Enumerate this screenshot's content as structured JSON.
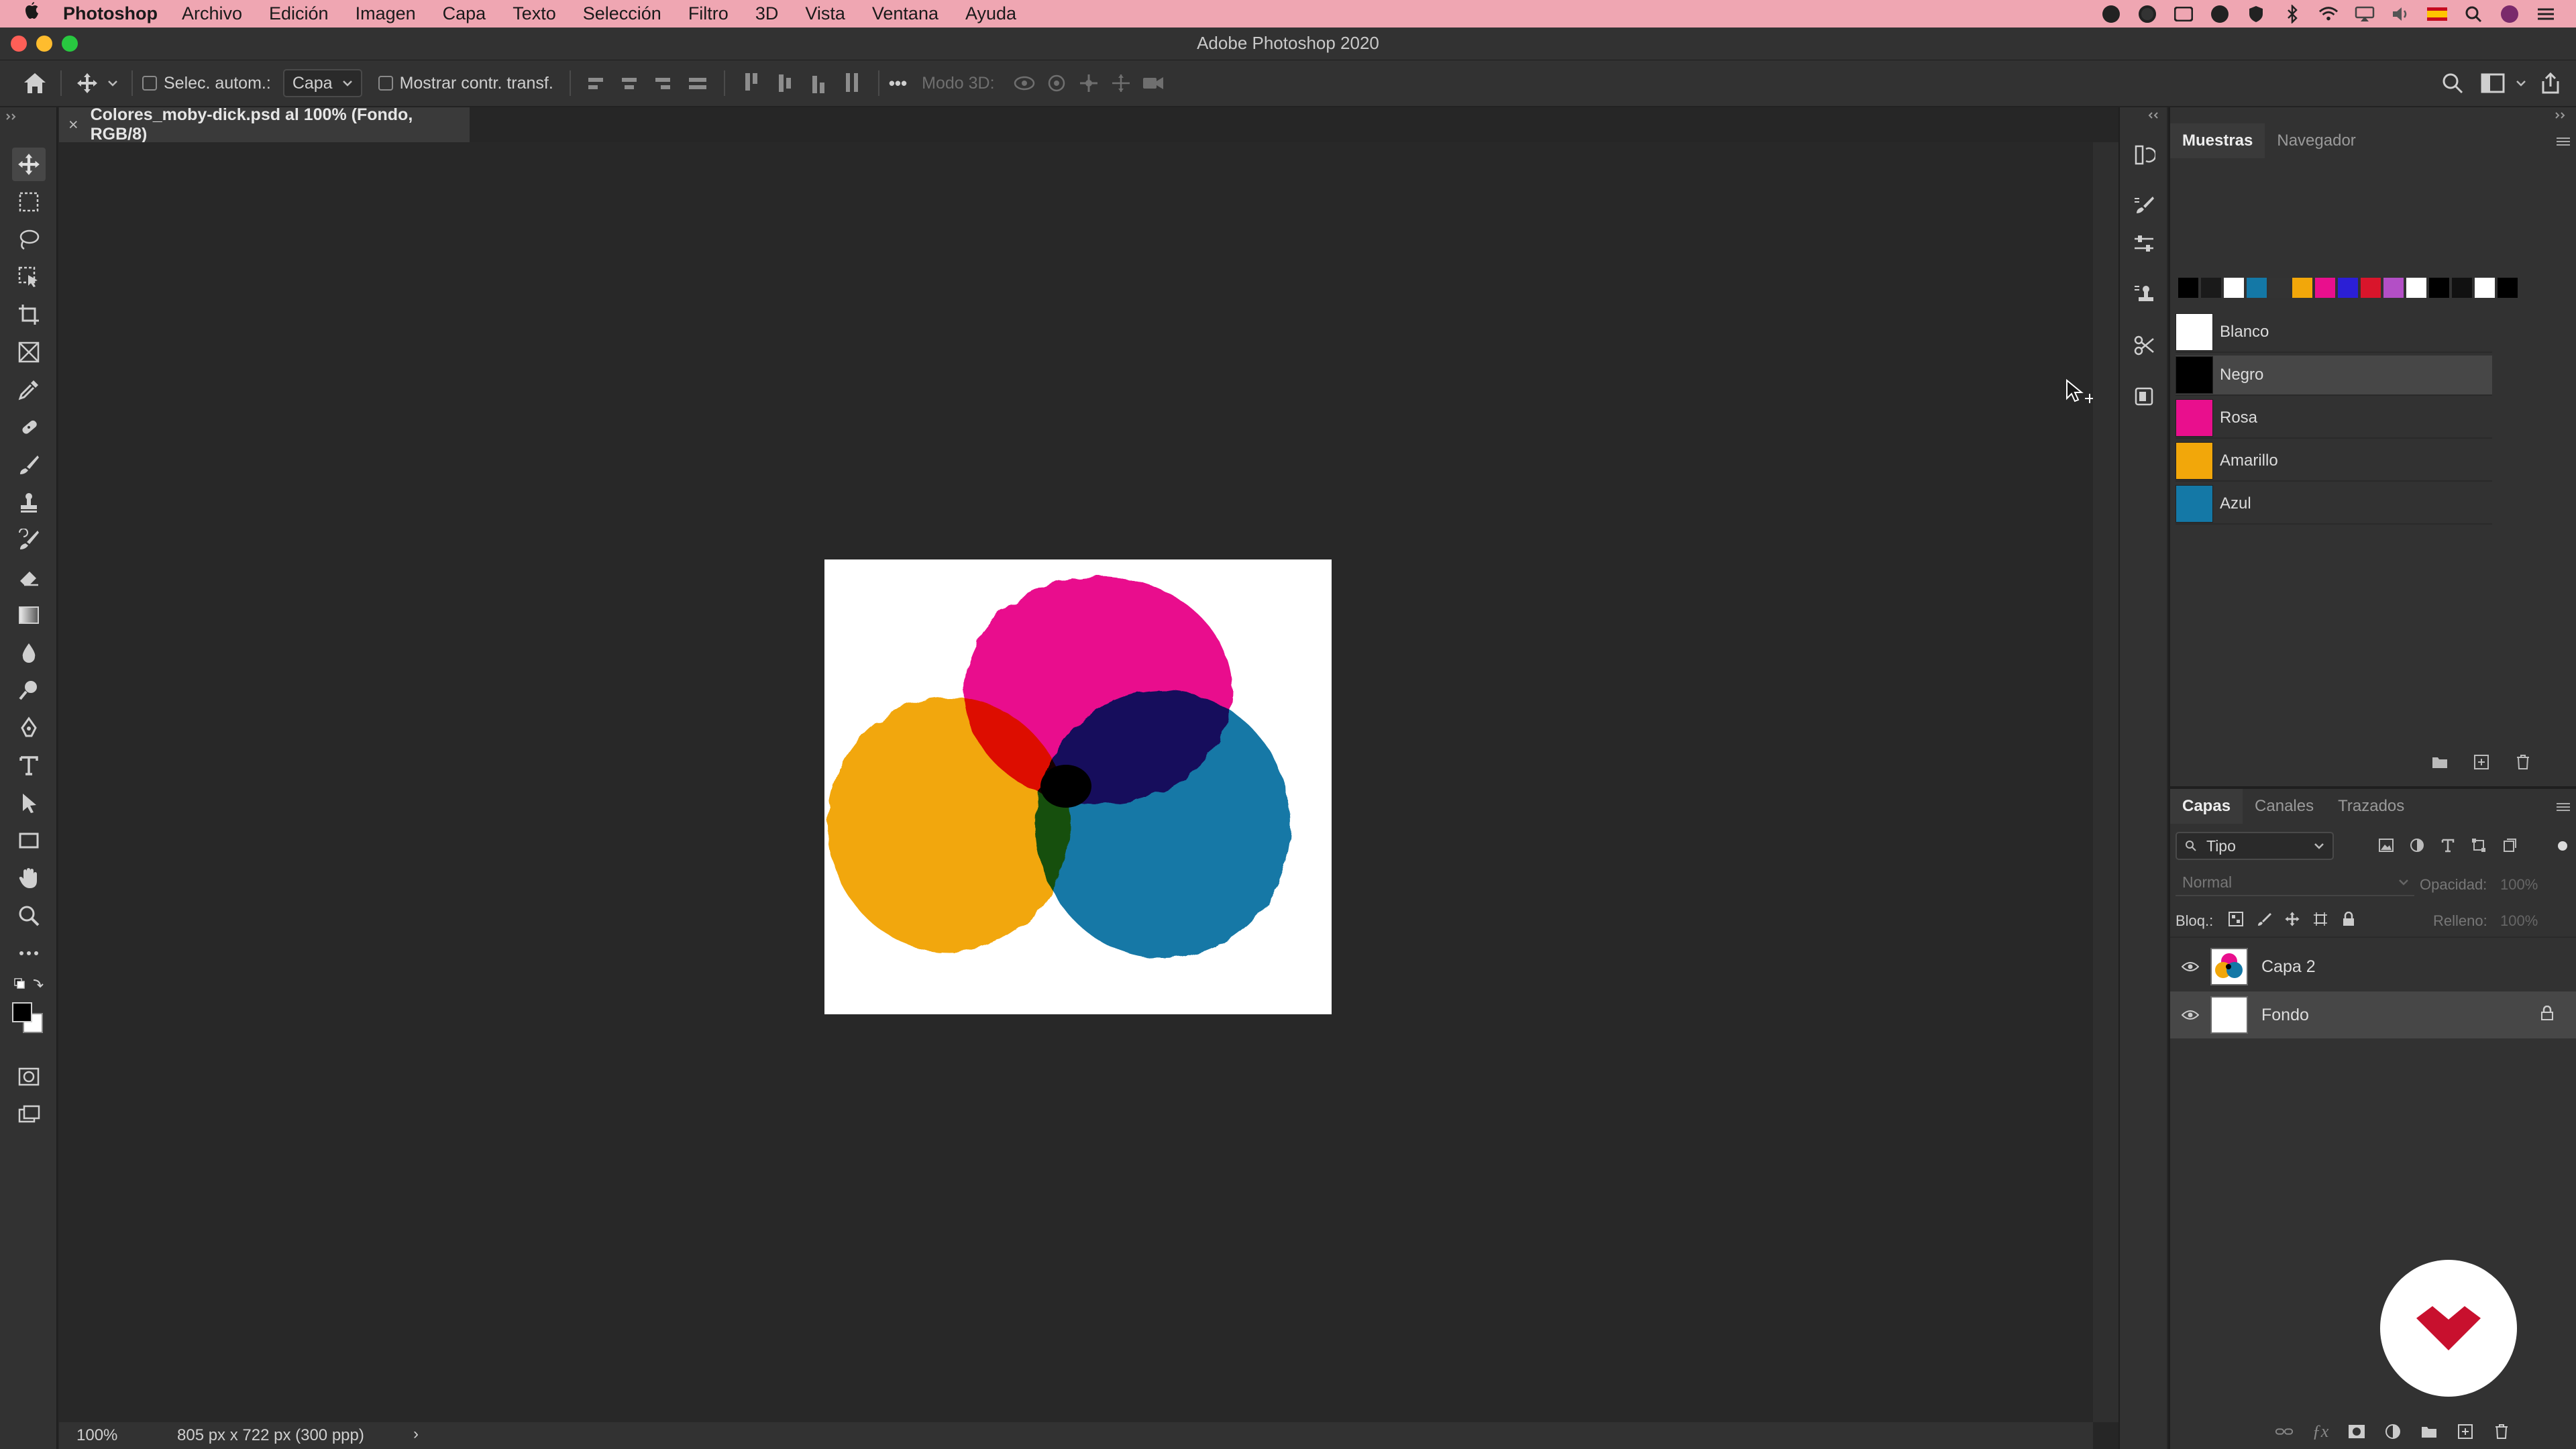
{
  "menubar": {
    "app_name": "Photoshop",
    "items": [
      "Archivo",
      "Edición",
      "Imagen",
      "Capa",
      "Texto",
      "Selección",
      "Filtro",
      "3D",
      "Vista",
      "Ventana",
      "Ayuda"
    ],
    "status_icons": [
      "app-icon",
      "app-icon",
      "app-icon",
      "app-icon",
      "app-icon",
      "bluetooth-icon",
      "wifi-icon",
      "airplay-icon",
      "volume-icon",
      "flag-es-icon",
      "search-icon",
      "avatar-icon",
      "control-center-icon"
    ]
  },
  "window": {
    "title": "Adobe Photoshop 2020"
  },
  "options": {
    "auto_select_label": "Selec. autom.:",
    "auto_select_value": "Capa",
    "show_transform_label": "Mostrar contr. transf.",
    "mode3d_label": "Modo 3D:",
    "more_label": "•••"
  },
  "document": {
    "tab_title": "Colores_moby-dick.psd al 100% (Fondo, RGB/8)",
    "close_glyph": "×",
    "zoom": "100%",
    "info": "805 px x 722 px (300 ppp)",
    "info_arrow": "›"
  },
  "swatches_panel": {
    "tabs": [
      "Muestras",
      "Navegador"
    ],
    "palette": [
      "#000000",
      "#1a1a1a",
      "#ffffff",
      "#1478a6",
      "#333333",
      "#f2a70a",
      "#e90f8d",
      "#2b1fd6",
      "#d9152b",
      "#b34fc6",
      "#ffffff",
      "#000000",
      "#111111",
      "#ffffff",
      "#000000"
    ],
    "items": [
      {
        "name": "Blanco",
        "color": "#ffffff"
      },
      {
        "name": "Negro",
        "color": "#000000"
      },
      {
        "name": "Rosa",
        "color": "#e90f8d"
      },
      {
        "name": "Amarillo",
        "color": "#f2a70a"
      },
      {
        "name": "Azul",
        "color": "#1478a6"
      }
    ]
  },
  "layers_panel": {
    "tabs": [
      "Capas",
      "Canales",
      "Trazados"
    ],
    "filter_value": "Tipo",
    "blend_mode": "Normal",
    "opacity_label": "Opacidad:",
    "opacity_value": "100%",
    "lock_label": "Bloq.:",
    "fill_label": "Relleno:",
    "fill_value": "100%",
    "layers": [
      {
        "name": "Capa 2"
      },
      {
        "name": "Fondo"
      }
    ]
  },
  "colors": {
    "magenta": "#e90f8d",
    "yellow": "#f2a70a",
    "cyan": "#1478a6",
    "accent_badge": "#c8102e"
  }
}
